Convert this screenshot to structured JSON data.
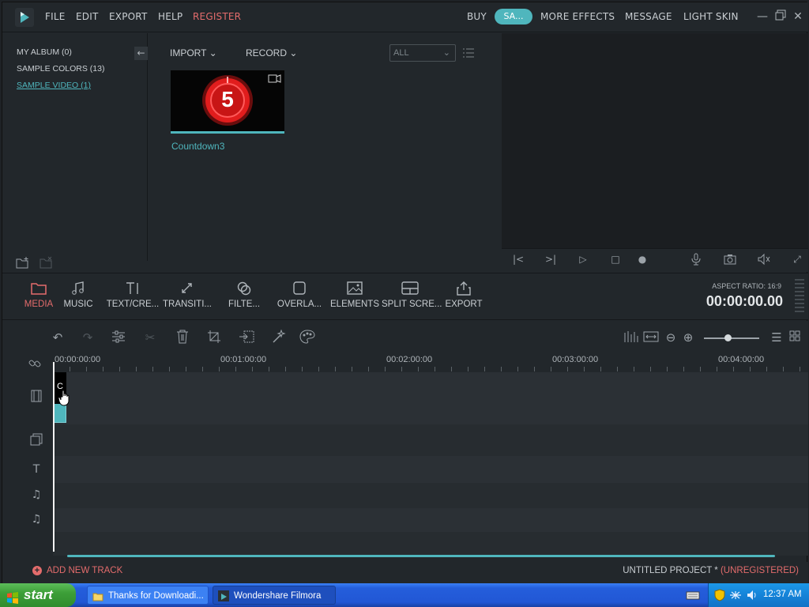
{
  "menu": {
    "file": "FILE",
    "edit": "EDIT",
    "export": "EXPORT",
    "help": "HELP",
    "register": "REGISTER",
    "buy": "BUY",
    "save_pill": "SA...",
    "more_effects": "MORE EFFECTS",
    "message": "MESSAGE",
    "light_skin": "LIGHT SKIN"
  },
  "library": {
    "items": [
      {
        "label": "MY ALBUM (0)"
      },
      {
        "label": "SAMPLE COLORS (13)"
      },
      {
        "label": "SAMPLE VIDEO (1)"
      }
    ],
    "collapse_icon": "arrow-left-icon"
  },
  "media": {
    "import_label": "IMPORT",
    "record_label": "RECORD",
    "filter_value": "ALL",
    "clips": [
      {
        "name": "Countdown3",
        "number": "5"
      }
    ]
  },
  "toolbar": {
    "items": [
      {
        "label": "MEDIA",
        "icon": "folder-icon"
      },
      {
        "label": "MUSIC",
        "icon": "music-note-icon"
      },
      {
        "label": "TEXT/CRE...",
        "icon": "text-icon"
      },
      {
        "label": "TRANSITI...",
        "icon": "transition-icon"
      },
      {
        "label": "FILTE...",
        "icon": "filter-icon"
      },
      {
        "label": "OVERLA...",
        "icon": "overlay-icon"
      },
      {
        "label": "ELEMENTS",
        "icon": "image-icon"
      },
      {
        "label": "SPLIT SCRE...",
        "icon": "split-screen-icon"
      },
      {
        "label": "EXPORT",
        "icon": "share-icon"
      }
    ],
    "aspect_ratio": "ASPECT RATIO: 16:9",
    "timecode": "00:00:00.00"
  },
  "timeline": {
    "ruler": [
      "00:00:00:00",
      "00:01:00:00",
      "00:02:00:00",
      "00:03:00:00",
      "00:04:00:00"
    ],
    "clip_label": "C",
    "add_track": "ADD NEW TRACK",
    "project_name": "UNTITLED PROJECT *",
    "project_status": "(UNREGISTERED)"
  },
  "taskbar": {
    "start": "start",
    "tasks": [
      {
        "label": "Thanks for Downloadi..."
      },
      {
        "label": "Wondershare Filmora"
      }
    ],
    "clock": "12:37 AM"
  },
  "colors": {
    "accent": "#4fb6bd",
    "register": "#e46c6c",
    "panel": "#22272b"
  }
}
